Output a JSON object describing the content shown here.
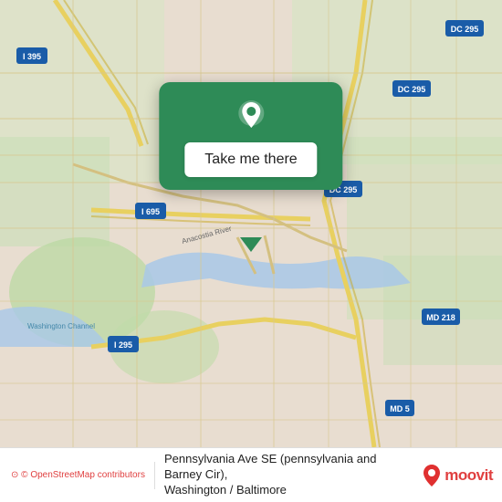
{
  "map": {
    "background_color": "#e8e0d8",
    "center_lat": 38.865,
    "center_lon": -76.98
  },
  "popup": {
    "button_label": "Take me there",
    "pin_color": "#ffffff",
    "background_color": "#2e8b57"
  },
  "footer": {
    "osm_text": "© OpenStreetMap contributors",
    "address_line1": "Pennsylvania Ave SE (pennsylvania and Barney Cir),",
    "address_line2": "Washington / Baltimore",
    "brand_name": "moovit"
  },
  "icons": {
    "map_pin": "map-pin-icon",
    "brand_pin": "brand-pin-icon"
  }
}
